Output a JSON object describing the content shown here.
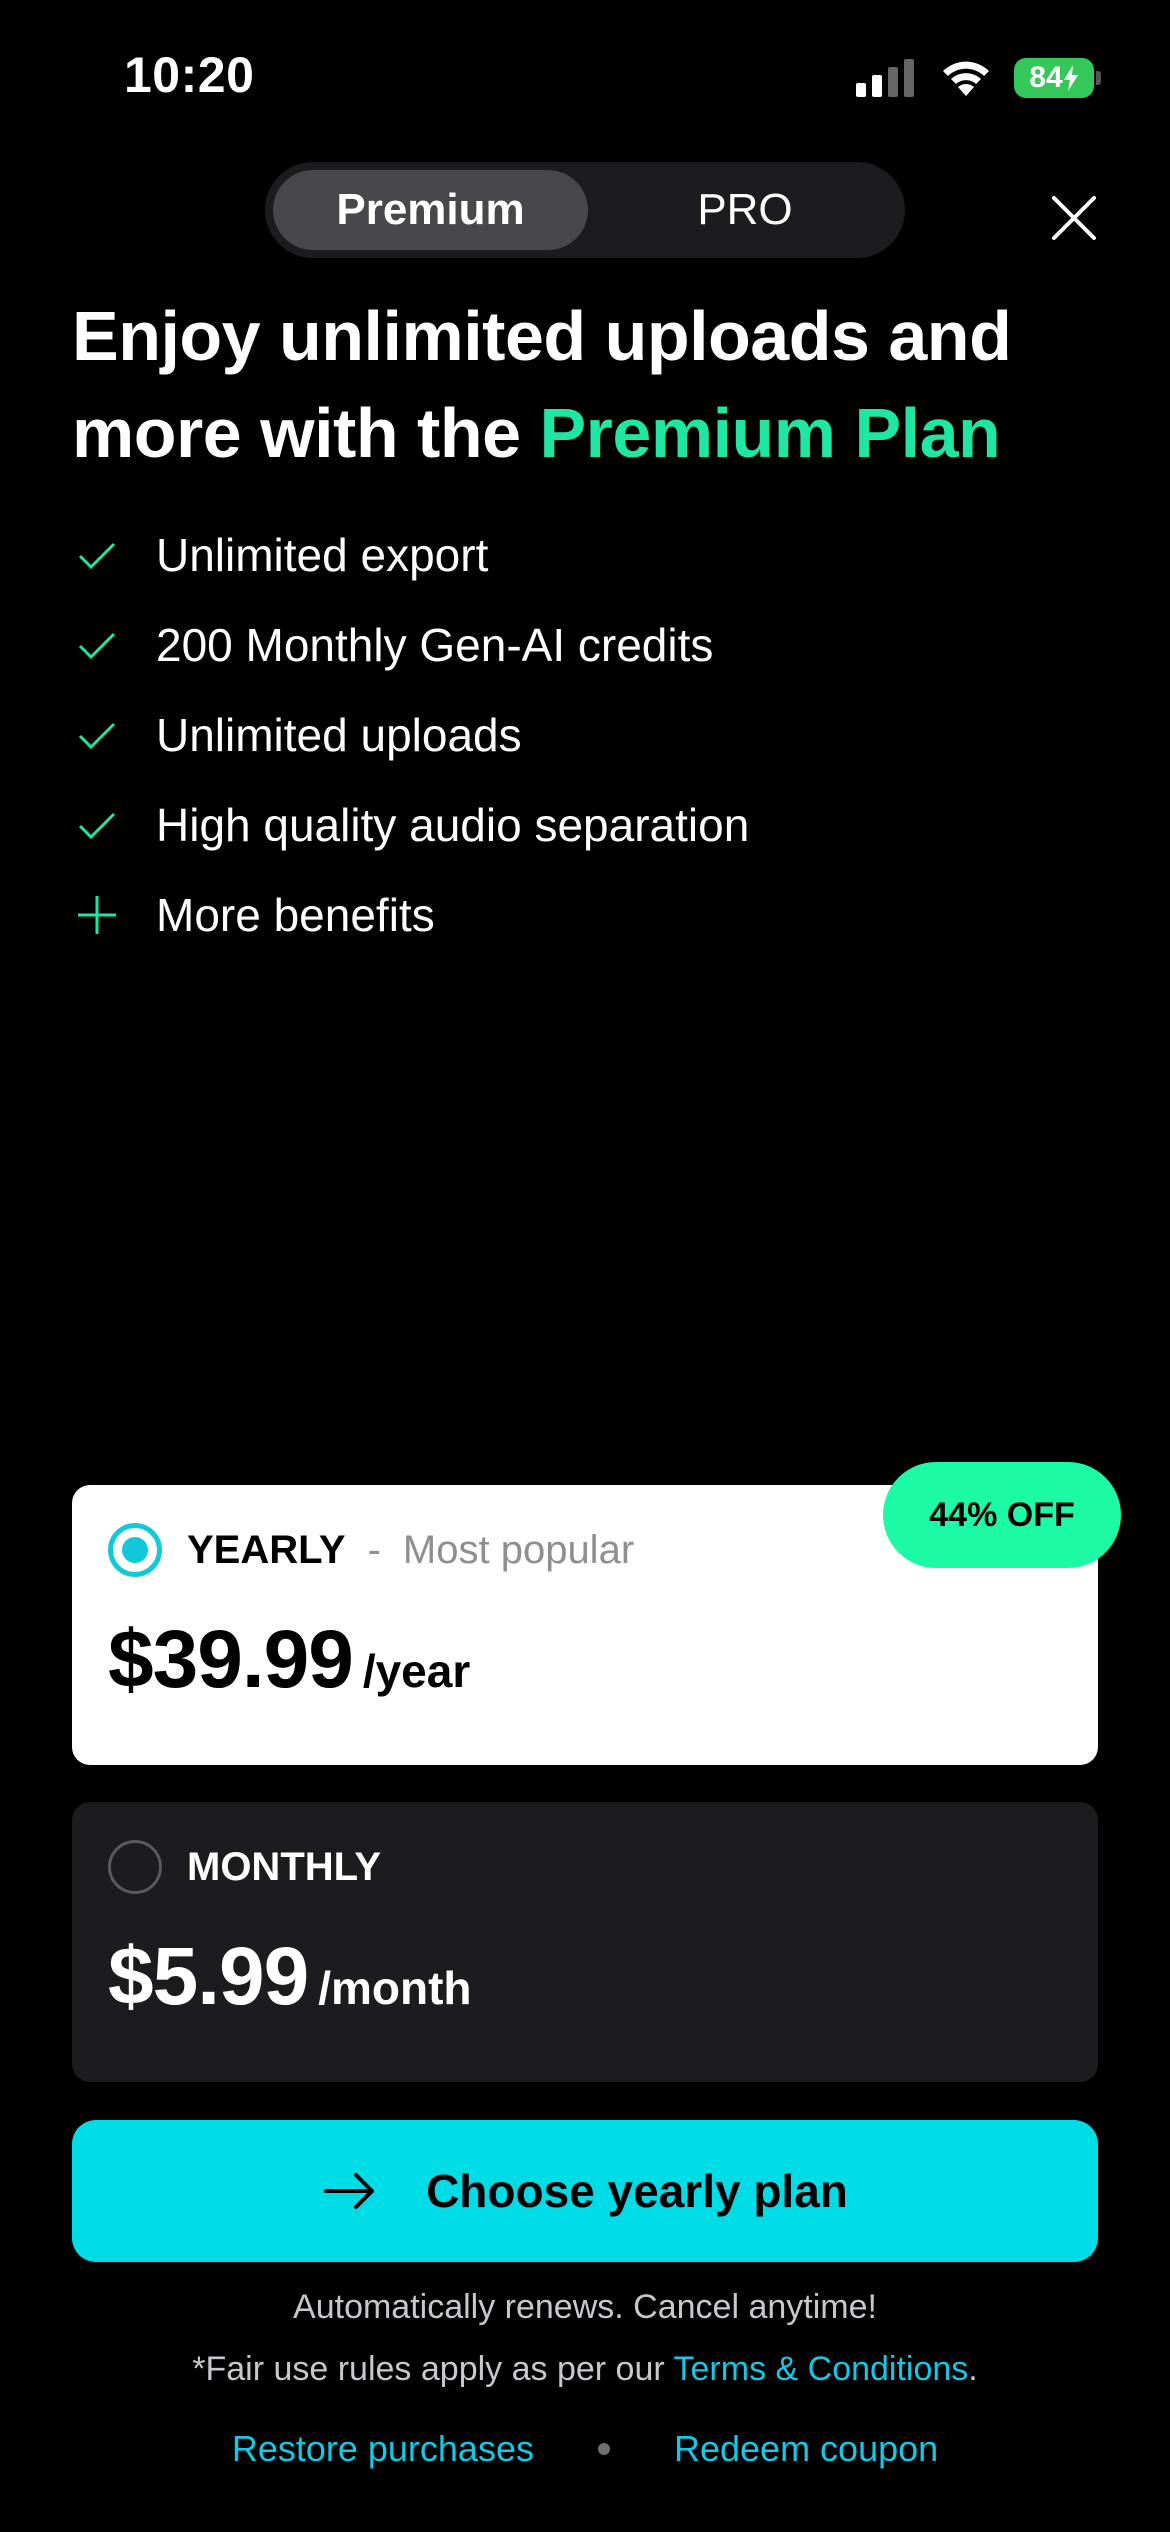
{
  "status_bar": {
    "time": "10:20",
    "battery": "84",
    "icons": [
      "signal-icon",
      "wifi-icon",
      "battery-charging-icon"
    ]
  },
  "toggle": {
    "premium_label": "Premium",
    "pro_label": "PRO",
    "selected": "Premium"
  },
  "headline": {
    "line_prefix": "Enjoy unlimited uploads and more with the ",
    "accent": "Premium Plan",
    "accent_color": "#1fe6a2"
  },
  "benefits": [
    {
      "icon": "check-icon",
      "text": "Unlimited export"
    },
    {
      "icon": "check-icon",
      "text": "200 Monthly Gen-AI credits"
    },
    {
      "icon": "check-icon",
      "text": "Unlimited uploads"
    },
    {
      "icon": "check-icon",
      "text": "High quality audio separation"
    },
    {
      "icon": "plus-icon",
      "text": "More benefits"
    }
  ],
  "plans": {
    "yearly": {
      "name": "YEARLY",
      "separator": "-",
      "subtitle": "Most popular",
      "price": "$39.99",
      "period": "/year",
      "selected": true,
      "badge": "44% OFF"
    },
    "monthly": {
      "name": "MONTHLY",
      "price": "$5.99",
      "period": "/month",
      "selected": false
    }
  },
  "cta": {
    "label": "Choose yearly plan",
    "color": "#00dce6"
  },
  "footer": {
    "renew_note": "Automatically renews. Cancel anytime!",
    "fair_use_prefix": "*Fair use rules apply as per our ",
    "terms_link": "Terms & Conditions",
    "fair_use_suffix": ".",
    "restore_label": "Restore purchases",
    "redeem_label": "Redeem coupon",
    "link_color": "#14c8e6"
  }
}
